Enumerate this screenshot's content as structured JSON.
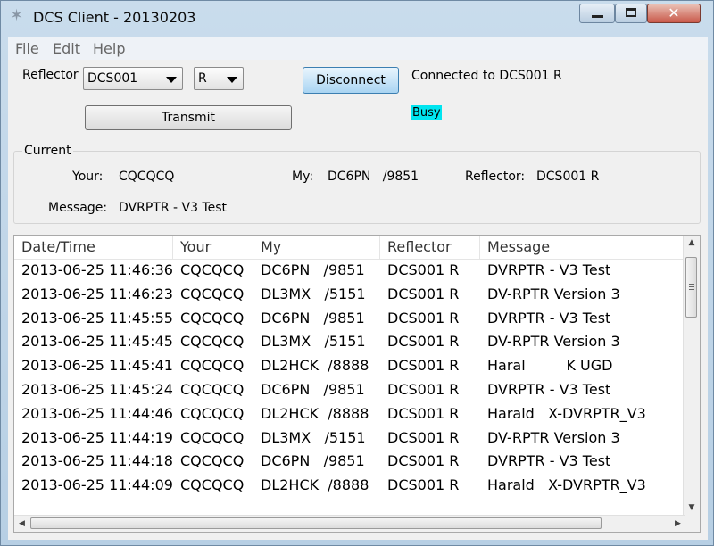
{
  "window": {
    "title": "DCS Client - 20130203",
    "close_glyph": "✕"
  },
  "menu": [
    "File",
    "Edit",
    "Help"
  ],
  "controls": {
    "reflector_label": "Reflector",
    "reflector_value": "DCS001",
    "module_value": "R",
    "disconnect_label": "Disconnect",
    "transmit_label": "Transmit",
    "status_text": "Connected to DCS001 R",
    "busy_text": "Busy",
    "busy_color": "#00e5f0"
  },
  "current": {
    "group_title": "Current",
    "your_label": "Your:",
    "your_value": "CQCQCQ",
    "my_label": "My:",
    "my_value": "DC6PN   /9851",
    "reflector_label": "Reflector:",
    "reflector_value": "DCS001 R",
    "message_label": "Message:",
    "message_value": "DVRPTR - V3 Test"
  },
  "table": {
    "columns": [
      "Date/Time",
      "Your",
      "My",
      "Reflector",
      "Message"
    ],
    "rows": [
      [
        "2013-06-25 11:46:36",
        "CQCQCQ",
        "DC6PN   /9851",
        "DCS001 R",
        "DVRPTR - V3 Test"
      ],
      [
        "2013-06-25 11:46:23",
        "CQCQCQ",
        "DL3MX   /5151",
        "DCS001 R",
        "DV-RPTR Version 3"
      ],
      [
        "2013-06-25 11:45:55",
        "CQCQCQ",
        "DC6PN   /9851",
        "DCS001 R",
        "DVRPTR - V3 Test"
      ],
      [
        "2013-06-25 11:45:45",
        "CQCQCQ",
        "DL3MX   /5151",
        "DCS001 R",
        "DV-RPTR Version 3"
      ],
      [
        "2013-06-25 11:45:41",
        "CQCQCQ",
        "DL2HCK  /8888",
        "DCS001 R",
        "Haral         K UGD"
      ],
      [
        "2013-06-25 11:45:24",
        "CQCQCQ",
        "DC6PN   /9851",
        "DCS001 R",
        "DVRPTR - V3 Test"
      ],
      [
        "2013-06-25 11:44:46",
        "CQCQCQ",
        "DL2HCK  /8888",
        "DCS001 R",
        "Harald   X-DVRPTR_V3"
      ],
      [
        "2013-06-25 11:44:19",
        "CQCQCQ",
        "DL3MX   /5151",
        "DCS001 R",
        "DV-RPTR Version 3"
      ],
      [
        "2013-06-25 11:44:18",
        "CQCQCQ",
        "DC6PN   /9851",
        "DCS001 R",
        "DVRPTR - V3 Test"
      ],
      [
        "2013-06-25 11:44:09",
        "CQCQCQ",
        "DL2HCK  /8888",
        "DCS001 R",
        "Harald   X-DVRPTR_V3"
      ]
    ]
  }
}
